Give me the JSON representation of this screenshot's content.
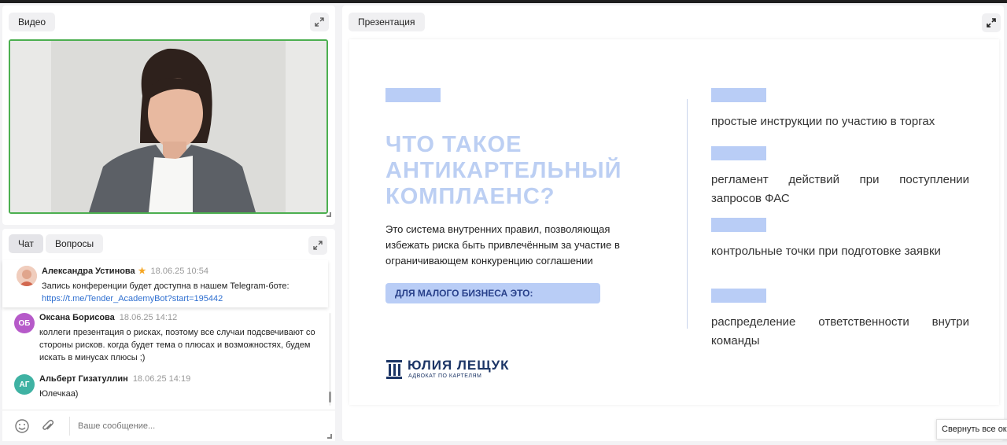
{
  "video_panel": {
    "tab_label": "Видео"
  },
  "chat_panel": {
    "tab_chat": "Чат",
    "tab_questions": "Вопросы",
    "pinned_message": {
      "author": "Александра Устинова",
      "time": "18.06.25 10:54",
      "text": "Запись конференции будет доступна в нашем Telegram-боте:",
      "link": "https://t.me/Tender_AcademyBot?start=195442"
    },
    "messages": [
      {
        "initials": "ОБ",
        "avatar_color": "#b65ac9",
        "author": "Оксана Борисова",
        "time": "18.06.25 14:12",
        "text": "коллеги презентация о рисках, поэтому все случаи подсвечивают со стороны рисков. когда будет тема о плюсах и возможностях, будем искать в минусах плюсы ;)"
      },
      {
        "initials": "АГ",
        "avatar_color": "#3fb2a3",
        "author": "Альберт Гизатуллин",
        "time": "18.06.25 14:19",
        "text": "Юлечкаа)"
      }
    ],
    "input_placeholder": "Ваше сообщение..."
  },
  "presentation_panel": {
    "tab_label": "Презентация",
    "slide": {
      "title": "ЧТО ТАКОЕ АНТИКАРТЕЛЬНЫЙ КОМПЛАЕНС?",
      "description": "Это система внутренних правил, позволяющая избежать риска быть привлечённым за участие в ограничивающем конкуренцию соглашении",
      "pill": "ДЛЯ МАЛОГО БИЗНЕСА ЭТО:",
      "items": [
        "простые инструкции по участию в торгах",
        "регламент действий при поступлении запросов ФАС",
        "контрольные точки при подготовке заявки",
        "распределение ответственности внутри команды"
      ],
      "logo_name": "ЮЛИЯ ЛЕЩУК",
      "logo_subtitle": "АДВОКАТ ПО КАРТЕЛЯМ"
    }
  },
  "tooltip": "Свернуть все окна",
  "colors": {
    "accent_green": "#4caf50",
    "slide_blue": "#b9cdf6",
    "link": "#2f6fd0"
  }
}
